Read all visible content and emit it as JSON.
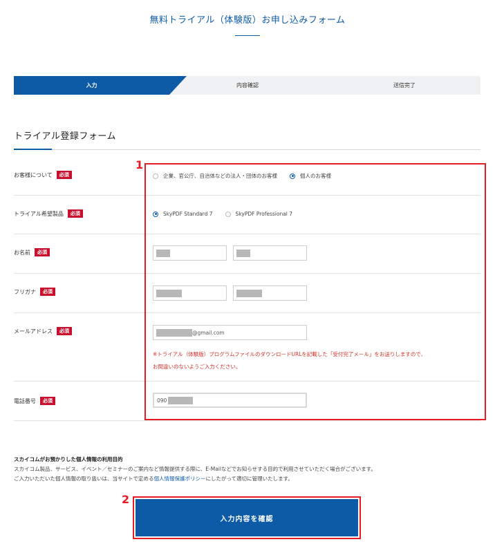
{
  "header": {
    "title": "無料トライアル（体験版）お申し込みフォーム"
  },
  "steps": [
    {
      "label": "入力",
      "active": true
    },
    {
      "label": "内容確認",
      "active": false
    },
    {
      "label": "送信完了",
      "active": false
    }
  ],
  "form": {
    "section_title": "トライアル登録フォーム",
    "required_badge": "必須",
    "customer_type": {
      "label": "お客様について",
      "options": [
        "企業、官公庁、自治体などの法人・団体のお客様",
        "個人のお客様"
      ],
      "selected": "個人のお客様"
    },
    "product": {
      "label": "トライアル希望製品",
      "options": [
        "SkyPDF Standard 7",
        "SkyPDF Professional 7"
      ],
      "selected": "SkyPDF Standard 7"
    },
    "name": {
      "label": "お名前"
    },
    "furigana": {
      "label": "フリガナ"
    },
    "email": {
      "label": "メールアドレス",
      "value_suffix": "@gmail.com",
      "note_line1": "※トライアル（体験版）プログラムファイルのダウンロードURLを記載した「受付完了メール」をお送りしますので、",
      "note_line2": "お間違いのないようご入力ください。"
    },
    "phone": {
      "label": "電話番号",
      "value_prefix": "090"
    }
  },
  "privacy": {
    "title": "スカイコムがお預かりした個人情報の利用目的",
    "line1": "スカイコム製品、サービス、イベント／セミナーのご案内など情報提供する際に、E-Mailなどでお知らせする目的で利用させていただく場合がございます。",
    "line2_pre": "ご入力いただいた個人情報の取り扱いは、当サイトで定める",
    "line2_link": "個人情報保護ポリシー",
    "line2_post": "にしたがって適切に管理いたします。"
  },
  "actions": {
    "confirm_label": "入力内容を確認"
  },
  "annotations": {
    "callout_1": "1",
    "callout_2": "2"
  },
  "colors": {
    "brand_blue": "#0d5aa7",
    "required_red": "#c8102e",
    "highlight_red": "#e61b23"
  }
}
